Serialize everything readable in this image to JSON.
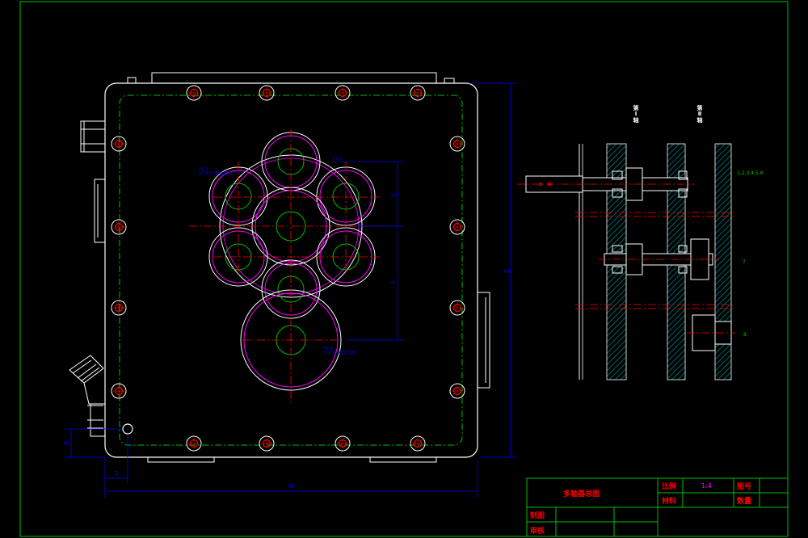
{
  "drawing": {
    "background": "#000000",
    "colors": {
      "frame": "#00c000",
      "outline": "#ffffff",
      "dimension": "#0000ff",
      "centerline": "#ff0000",
      "gear_magenta": "#ff00ff",
      "gear_green": "#00c000",
      "hatch": "#008080",
      "dim_text": "#0000ff",
      "title_text": "#ff0000"
    }
  },
  "front_view": {
    "dimensions": {
      "bottom_overall": "48",
      "bottom_small": "2",
      "left_small": "8",
      "right_overall": "48",
      "center_upper": "d3",
      "center_lower": "d"
    },
    "gear_notes": {
      "note_a_title": "FS-1",
      "note_a_sub": "m=3 z=22 d=66",
      "note_b_title": "FS-2",
      "note_c_title": "FS-3",
      "note_c_sub": "m=3 z=40 d=120"
    }
  },
  "side_view": {
    "shaft_labels": [
      "第Ⅰ轴",
      "第Ⅱ轴"
    ],
    "right_notes": [
      "1,2,3,4,5,6",
      "7",
      "8"
    ]
  },
  "title_block": {
    "drawing_name": "多轴器总图",
    "scale_label": "比例",
    "scale_value": "1:4",
    "drawing_no_label": "图号",
    "material_label": "材料",
    "quantity_label": "数量",
    "drawn_by_label": "制图",
    "checked_by_label": "审核"
  }
}
